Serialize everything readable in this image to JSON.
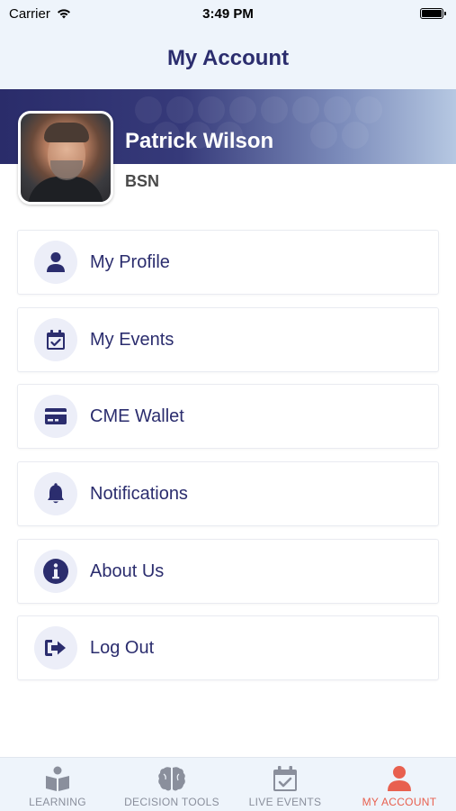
{
  "status_bar": {
    "carrier": "Carrier",
    "time": "3:49 PM"
  },
  "header": {
    "title": "My Account"
  },
  "profile": {
    "name": "Patrick Wilson",
    "credential": "BSN"
  },
  "menu": {
    "items": [
      {
        "label": "My Profile",
        "icon": "person-icon"
      },
      {
        "label": "My Events",
        "icon": "calendar-check-icon"
      },
      {
        "label": "CME Wallet",
        "icon": "credit-card-icon"
      },
      {
        "label": "Notifications",
        "icon": "bell-icon"
      },
      {
        "label": "About Us",
        "icon": "info-icon"
      },
      {
        "label": "Log Out",
        "icon": "log-out-icon"
      }
    ]
  },
  "tab_bar": {
    "tabs": [
      {
        "label": "LEARNING",
        "icon": "book-reader-icon",
        "active": false
      },
      {
        "label": "DECISION TOOLS",
        "icon": "brain-icon",
        "active": false
      },
      {
        "label": "LIVE EVENTS",
        "icon": "calendar-check-icon",
        "active": false
      },
      {
        "label": "MY ACCOUNT",
        "icon": "person-icon",
        "active": true
      }
    ]
  },
  "colors": {
    "primary": "#2b2d6e",
    "accent": "#e8604f",
    "inactive_tab": "#8a8f9c",
    "header_bg": "#eef4fb"
  }
}
